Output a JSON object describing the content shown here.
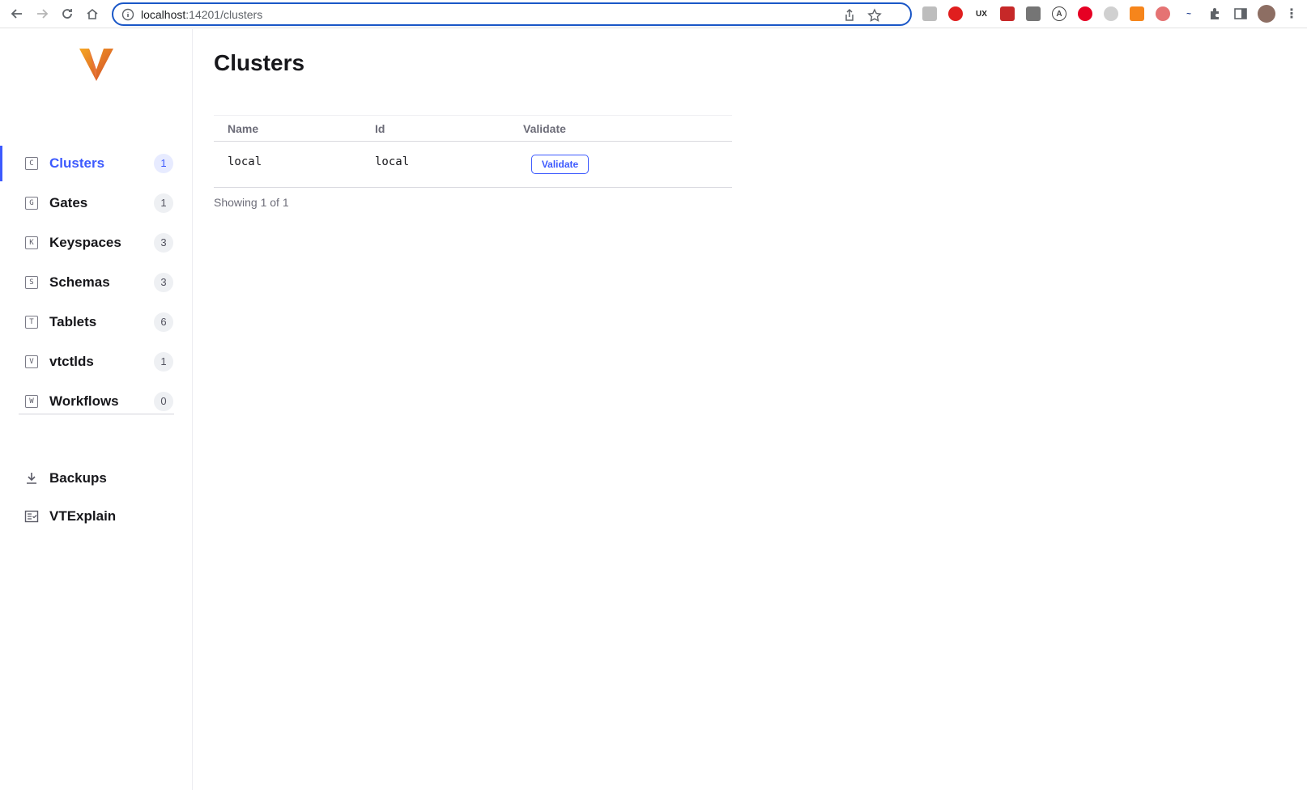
{
  "browser": {
    "url_host": "localhost",
    "url_path": ":14201/clusters"
  },
  "sidebar": {
    "items": [
      {
        "letter": "C",
        "label": "Clusters",
        "count": "1"
      },
      {
        "letter": "G",
        "label": "Gates",
        "count": "1"
      },
      {
        "letter": "K",
        "label": "Keyspaces",
        "count": "3"
      },
      {
        "letter": "S",
        "label": "Schemas",
        "count": "3"
      },
      {
        "letter": "T",
        "label": "Tablets",
        "count": "6"
      },
      {
        "letter": "V",
        "label": "vtctlds",
        "count": "1"
      },
      {
        "letter": "W",
        "label": "Workflows",
        "count": "0"
      }
    ],
    "tools": [
      {
        "label": "Backups",
        "icon": "download-icon"
      },
      {
        "label": "VTExplain",
        "icon": "explain-icon"
      }
    ],
    "active_color": "#3d5afe"
  },
  "main": {
    "title": "Clusters",
    "table": {
      "headers": [
        "Name",
        "Id",
        "Validate"
      ],
      "rows": [
        {
          "name": "local",
          "id": "local",
          "action": "Validate"
        }
      ]
    },
    "showing": "Showing 1 of 1"
  }
}
